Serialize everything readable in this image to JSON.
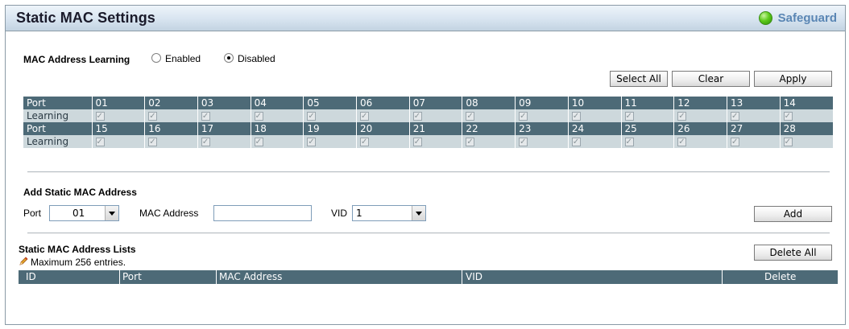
{
  "title": "Static MAC Settings",
  "safeguard": "Safeguard",
  "learning": {
    "label": "MAC Address Learning",
    "enabled": "Enabled",
    "disabled": "Disabled",
    "selected": "Disabled"
  },
  "buttons": {
    "select_all": "Select All",
    "clear": "Clear",
    "apply": "Apply",
    "add": "Add",
    "delete_all": "Delete All"
  },
  "port_table": {
    "port_label": "Port",
    "learning_label": "Learning",
    "row1": [
      "01",
      "02",
      "03",
      "04",
      "05",
      "06",
      "07",
      "08",
      "09",
      "10",
      "11",
      "12",
      "13",
      "14"
    ],
    "row2": [
      "15",
      "16",
      "17",
      "18",
      "19",
      "20",
      "21",
      "22",
      "23",
      "24",
      "25",
      "26",
      "27",
      "28"
    ]
  },
  "add_section": {
    "heading": "Add Static MAC Address",
    "port_label": "Port",
    "port_value": "01",
    "mac_label": "MAC Address",
    "mac_value": "",
    "vid_label": "VID",
    "vid_value": "1"
  },
  "list_section": {
    "heading": "Static MAC Address Lists",
    "note": "Maximum 256 entries.",
    "columns": [
      "ID",
      "Port",
      "MAC Address",
      "VID",
      "Delete"
    ]
  }
}
